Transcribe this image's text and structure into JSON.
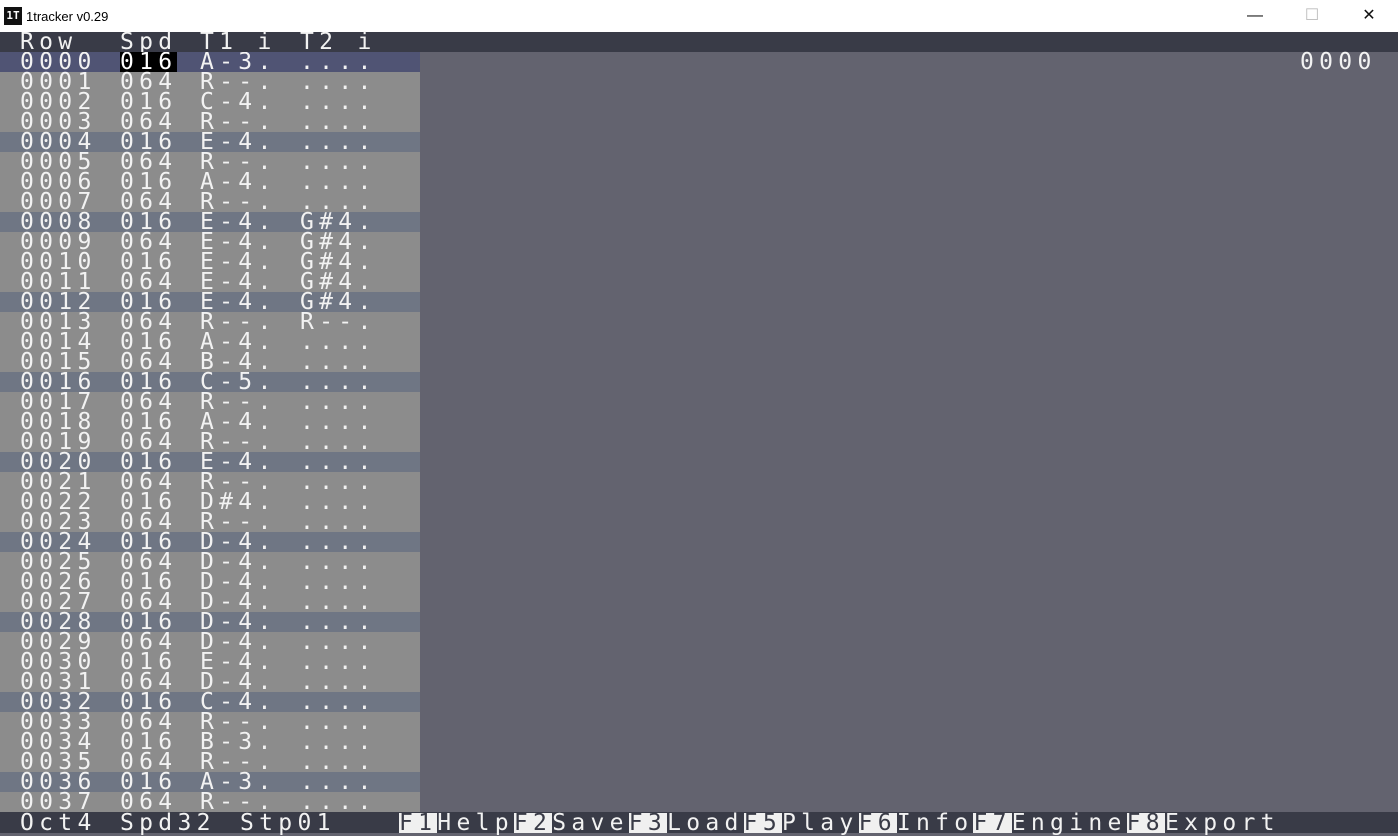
{
  "window": {
    "title": "1tracker v0.29",
    "icon": "1T",
    "controls": {
      "minimize": "—",
      "maximize": "☐",
      "close": "✕"
    }
  },
  "columns": {
    "row": "Row",
    "spd": "Spd",
    "t1": "T1 i",
    "t2": "T2 i"
  },
  "position_readout": "0000",
  "selected": {
    "row": 0,
    "column": "spd"
  },
  "highlight_every": 4,
  "rows": [
    {
      "row": "0000",
      "spd": "016",
      "t1": "A-3.",
      "t2": "...."
    },
    {
      "row": "0001",
      "spd": "064",
      "t1": "R--.",
      "t2": "...."
    },
    {
      "row": "0002",
      "spd": "016",
      "t1": "C-4.",
      "t2": "...."
    },
    {
      "row": "0003",
      "spd": "064",
      "t1": "R--.",
      "t2": "...."
    },
    {
      "row": "0004",
      "spd": "016",
      "t1": "E-4.",
      "t2": "...."
    },
    {
      "row": "0005",
      "spd": "064",
      "t1": "R--.",
      "t2": "...."
    },
    {
      "row": "0006",
      "spd": "016",
      "t1": "A-4.",
      "t2": "...."
    },
    {
      "row": "0007",
      "spd": "064",
      "t1": "R--.",
      "t2": "...."
    },
    {
      "row": "0008",
      "spd": "016",
      "t1": "E-4.",
      "t2": "G#4."
    },
    {
      "row": "0009",
      "spd": "064",
      "t1": "E-4.",
      "t2": "G#4."
    },
    {
      "row": "0010",
      "spd": "016",
      "t1": "E-4.",
      "t2": "G#4."
    },
    {
      "row": "0011",
      "spd": "064",
      "t1": "E-4.",
      "t2": "G#4."
    },
    {
      "row": "0012",
      "spd": "016",
      "t1": "E-4.",
      "t2": "G#4."
    },
    {
      "row": "0013",
      "spd": "064",
      "t1": "R--.",
      "t2": "R--."
    },
    {
      "row": "0014",
      "spd": "016",
      "t1": "A-4.",
      "t2": "...."
    },
    {
      "row": "0015",
      "spd": "064",
      "t1": "B-4.",
      "t2": "...."
    },
    {
      "row": "0016",
      "spd": "016",
      "t1": "C-5.",
      "t2": "...."
    },
    {
      "row": "0017",
      "spd": "064",
      "t1": "R--.",
      "t2": "...."
    },
    {
      "row": "0018",
      "spd": "016",
      "t1": "A-4.",
      "t2": "...."
    },
    {
      "row": "0019",
      "spd": "064",
      "t1": "R--.",
      "t2": "...."
    },
    {
      "row": "0020",
      "spd": "016",
      "t1": "E-4.",
      "t2": "...."
    },
    {
      "row": "0021",
      "spd": "064",
      "t1": "R--.",
      "t2": "...."
    },
    {
      "row": "0022",
      "spd": "016",
      "t1": "D#4.",
      "t2": "...."
    },
    {
      "row": "0023",
      "spd": "064",
      "t1": "R--.",
      "t2": "...."
    },
    {
      "row": "0024",
      "spd": "016",
      "t1": "D-4.",
      "t2": "...."
    },
    {
      "row": "0025",
      "spd": "064",
      "t1": "D-4.",
      "t2": "...."
    },
    {
      "row": "0026",
      "spd": "016",
      "t1": "D-4.",
      "t2": "...."
    },
    {
      "row": "0027",
      "spd": "064",
      "t1": "D-4.",
      "t2": "...."
    },
    {
      "row": "0028",
      "spd": "016",
      "t1": "D-4.",
      "t2": "...."
    },
    {
      "row": "0029",
      "spd": "064",
      "t1": "D-4.",
      "t2": "...."
    },
    {
      "row": "0030",
      "spd": "016",
      "t1": "E-4.",
      "t2": "...."
    },
    {
      "row": "0031",
      "spd": "064",
      "t1": "D-4.",
      "t2": "...."
    },
    {
      "row": "0032",
      "spd": "016",
      "t1": "C-4.",
      "t2": "...."
    },
    {
      "row": "0033",
      "spd": "064",
      "t1": "R--.",
      "t2": "...."
    },
    {
      "row": "0034",
      "spd": "016",
      "t1": "B-3.",
      "t2": "...."
    },
    {
      "row": "0035",
      "spd": "064",
      "t1": "R--.",
      "t2": "...."
    },
    {
      "row": "0036",
      "spd": "016",
      "t1": "A-3.",
      "t2": "...."
    },
    {
      "row": "0037",
      "spd": "064",
      "t1": "R--.",
      "t2": "...."
    }
  ],
  "status": {
    "oct": "Oct4",
    "spd": "Spd32",
    "stp": "Stp01"
  },
  "function_keys": [
    {
      "key": "F1",
      "label": "Help"
    },
    {
      "key": "F2",
      "label": "Save"
    },
    {
      "key": "F3",
      "label": "Load"
    },
    {
      "key": "F5",
      "label": "Play"
    },
    {
      "key": "F6",
      "label": "Info"
    },
    {
      "key": "F7",
      "label": "Engine"
    },
    {
      "key": "F8",
      "label": "Export"
    }
  ],
  "colors": {
    "background": "#63636f",
    "pattern_bg": "#8c8c8c",
    "beat_row": "#6f7684",
    "current_row": "#505474",
    "bars": "#393b47",
    "text": "#f2f2f2"
  }
}
